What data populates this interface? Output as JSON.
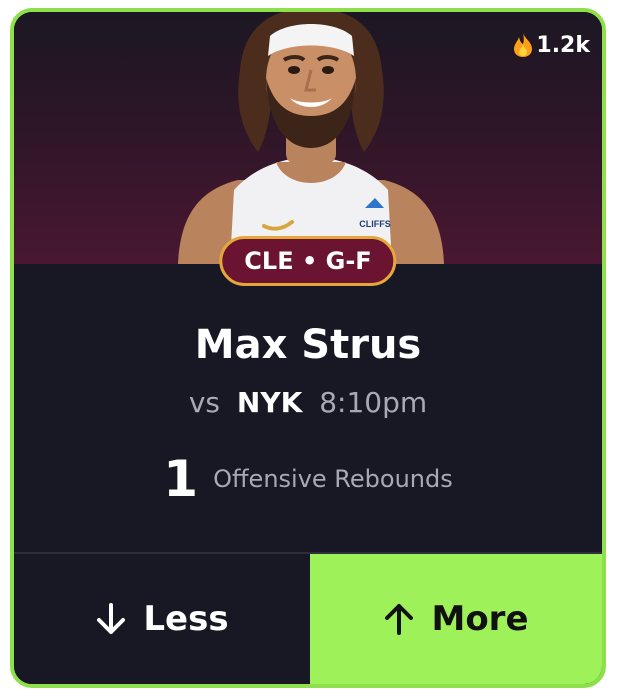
{
  "card": {
    "accent_color": "#8ee04a",
    "background_color": "#171824"
  },
  "popularity": {
    "icon": "fire-icon",
    "value": "1.2k"
  },
  "player": {
    "team": "CLE",
    "position": "G-F",
    "badge_text": "CLE • G-F",
    "name": "Max Strus",
    "jersey_text": "CLIFFS"
  },
  "matchup": {
    "prefix": "vs",
    "opponent": "NYK",
    "time": "8:10pm"
  },
  "stat": {
    "value": "1",
    "label": "Offensive Rebounds"
  },
  "actions": {
    "less_label": "Less",
    "more_label": "More",
    "more_color": "#9ff15a"
  }
}
